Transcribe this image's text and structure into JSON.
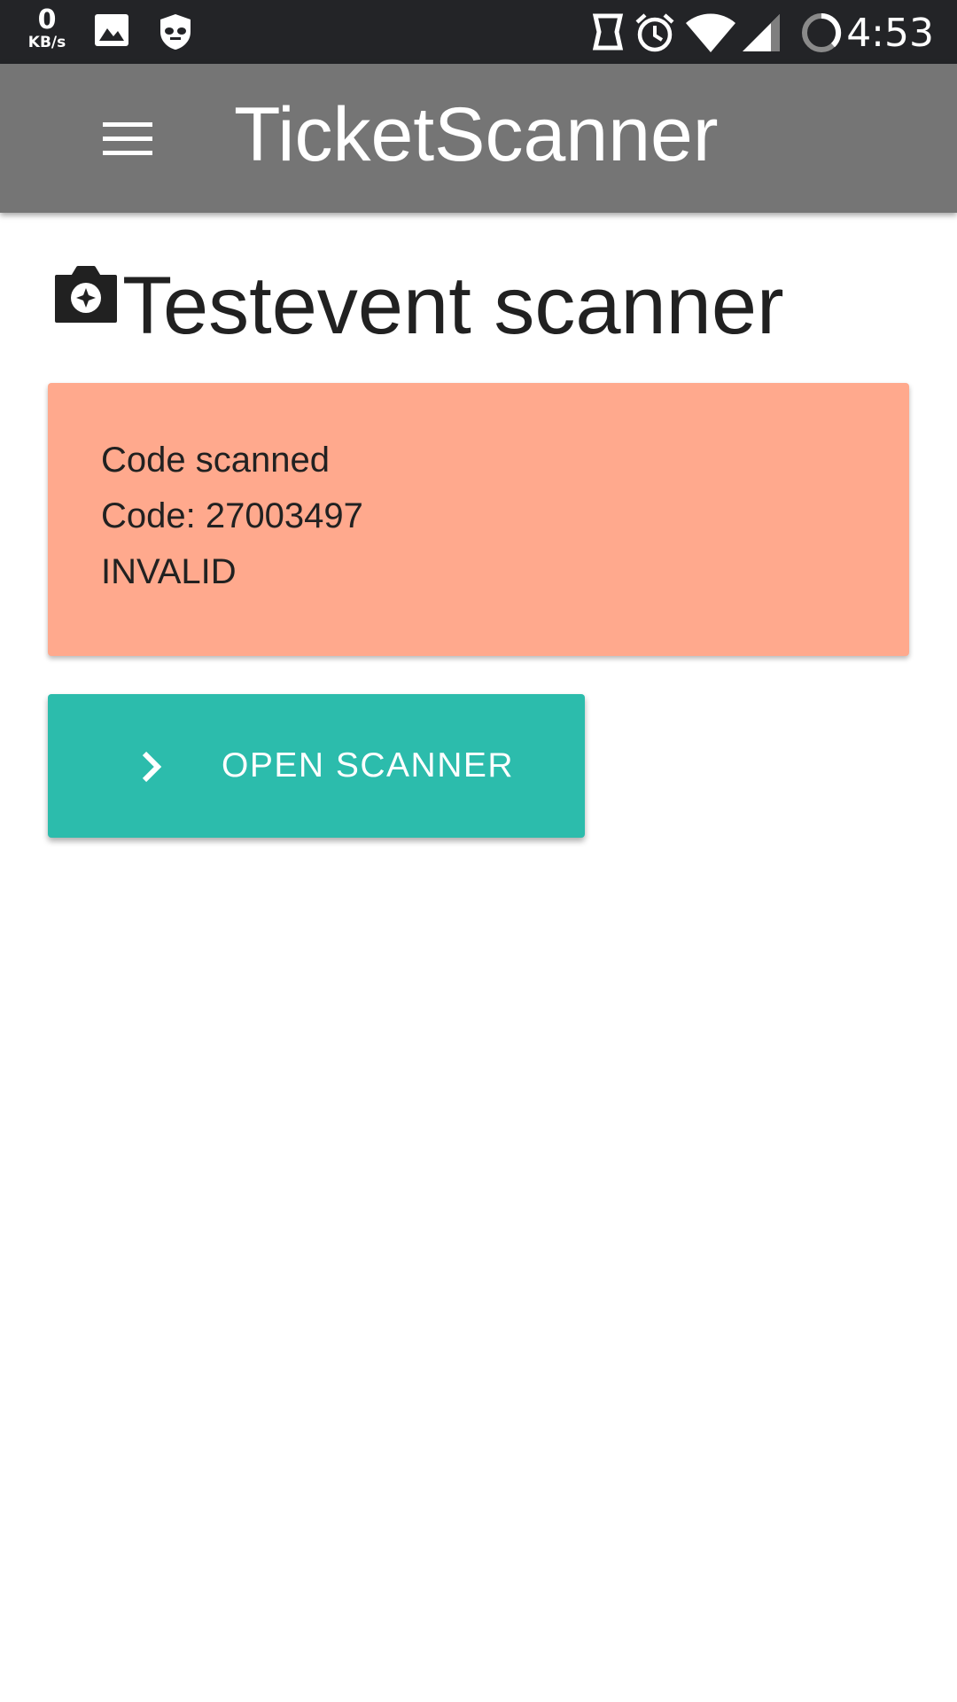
{
  "status_bar": {
    "net_speed_value": "0",
    "net_speed_unit": "KB/s",
    "time": "4:53",
    "icons": [
      "image-icon",
      "shield-mask-icon",
      "nfc-icon",
      "alarm-icon",
      "wifi-icon",
      "signal-icon",
      "sync-icon"
    ]
  },
  "app_bar": {
    "title": "TicketScanner",
    "menu_icon": "menu-icon"
  },
  "page": {
    "title": "Testevent scanner",
    "title_icon": "camera-icon"
  },
  "scan_result": {
    "status": "Code scanned",
    "code_line": "Code: 27003497",
    "validity": "INVALID",
    "background_color": "#ffa98d"
  },
  "actions": {
    "open_scanner_label": "OPEN SCANNER",
    "open_scanner_icon": "chevron-right-icon",
    "accent_color": "#2cbcac"
  }
}
